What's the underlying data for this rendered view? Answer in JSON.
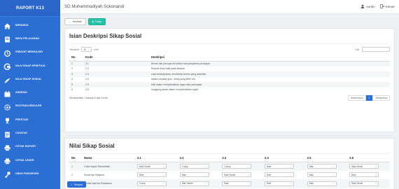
{
  "brand": "RAPORT K13",
  "sidebar": {
    "items": [
      {
        "label": "BERANDA",
        "icon": "home-icon"
      },
      {
        "label": "MATA PELAJARAN",
        "icon": "book-icon"
      },
      {
        "label": "RIWAYAT MENGAJAR",
        "icon": "history-icon"
      },
      {
        "label": "NILAI SIKAP SPIRITUAL",
        "icon": "google-icon"
      },
      {
        "label": "NILAI SIKAP SOSIAL",
        "icon": "thumbs-up-icon"
      },
      {
        "label": "ABSENSI",
        "icon": "calendar-icon"
      },
      {
        "label": "EKSTRAKURIKULER",
        "icon": "gear-icon"
      },
      {
        "label": "PRESTASI",
        "icon": "trophy-icon"
      },
      {
        "label": "CATATAN",
        "icon": "notes-icon"
      },
      {
        "label": "CETAK RAPORT",
        "icon": "print-icon"
      },
      {
        "label": "CETAK LEGER",
        "icon": "print-icon"
      },
      {
        "label": "UBAH PASSWORD",
        "icon": "key-icon"
      }
    ]
  },
  "topbar": {
    "school": "SD Muhammadiyah Sokonandi",
    "user": "nurdin",
    "logout": "Keluar"
  },
  "buttons": {
    "back": "Kembali",
    "add": "Tutup"
  },
  "panel1": {
    "title": "Isian Deskripsi Sikap Sosial",
    "show_label": "Tampilkan",
    "show_value": "10",
    "entries_label": "entri",
    "search_label": "Cari:",
    "headers": {
      "no": "No",
      "kode": "Kode",
      "deskripsi": "Deskripsi"
    },
    "rows": [
      {
        "no": "1",
        "kode": "2.1",
        "deskripsi": "Berani dan percaya diri ketika menyampaikan pendapat"
      },
      {
        "no": "2",
        "kode": "2.2",
        "deskripsi": "Respek serta baik pada ahasan"
      },
      {
        "no": "3",
        "kode": "2.3",
        "deskripsi": "suka bekerjasama, membantu teman yang kesulitan"
      },
      {
        "no": "4",
        "kode": "2.4",
        "deskripsi": "santun kepada guru, orang yang lebih tua"
      },
      {
        "no": "5",
        "kode": "2.5",
        "deskripsi": "teliti dalam menyelesaikan tugas atau pekerjaan"
      },
      {
        "no": "6",
        "kode": "2.6",
        "deskripsi": "tanggung jawab dalam menyelesaikan tugas"
      }
    ],
    "info": "Menampilkan 1 sampai 6 dari 6 entri",
    "pager": {
      "prev": "Sebelumnya",
      "page": "1",
      "next": "Selanjutnya"
    }
  },
  "panel2": {
    "title": "Nilai Sikap Sosial",
    "headers": [
      "No",
      "Nama",
      "2.1",
      "2.2",
      "2.3",
      "2.4",
      "2.5",
      "2.6"
    ],
    "rows": [
      {
        "no": "1",
        "nama": "Cutta Haydn Ramadhani",
        "values": [
          "Baik Sekali",
          "Cukup",
          "Cukup",
          "Baik",
          "Baik",
          "Baik Sekali"
        ]
      },
      {
        "no": "2",
        "nama": "Dinda Ayu Nirigrum",
        "values": [
          "Baik",
          "Baik",
          "Baik Sekali",
          "Baik",
          "Baik",
          "Baik"
        ]
      },
      {
        "no": "3",
        "nama": "ahmad rajdi koi Ekokamsu",
        "values": [
          "Cukup",
          "Baik Sekali",
          "Baik",
          "Baik",
          "Baik",
          "Baik Sekali"
        ]
      }
    ]
  },
  "save": "Simpan",
  "colors": {
    "sidebar": "#2b6fd4",
    "accent_green": "#26c2a7"
  }
}
